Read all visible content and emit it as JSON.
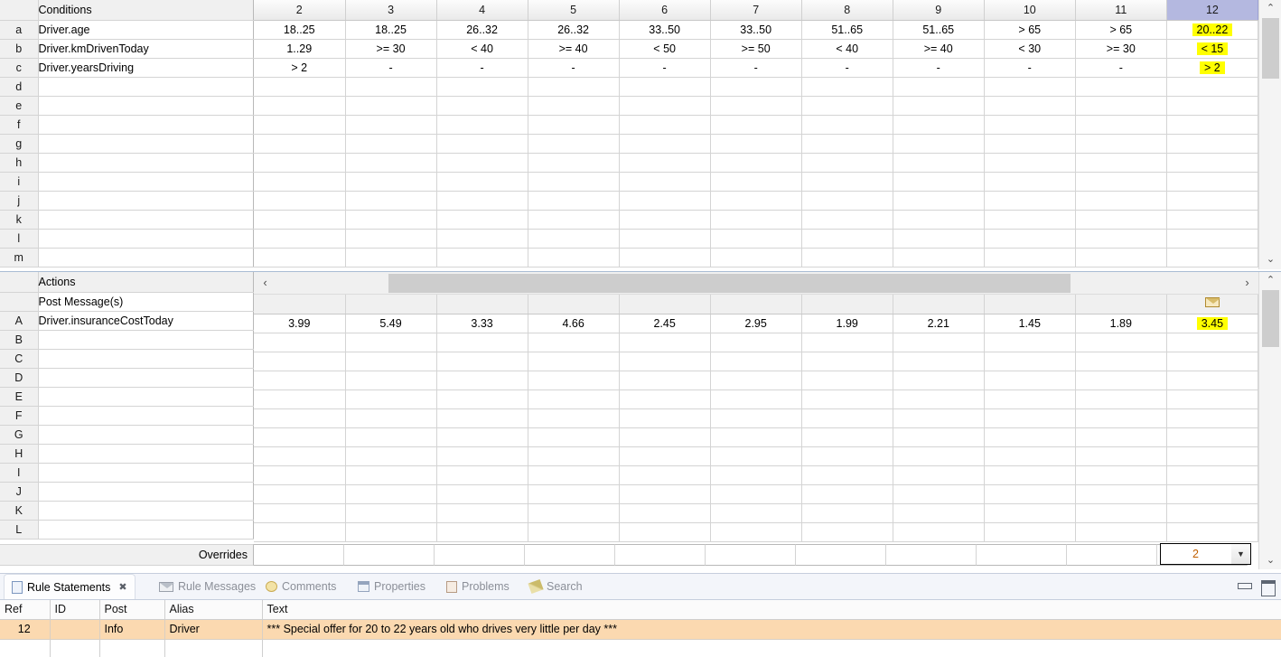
{
  "decision_table": {
    "conditions": {
      "section_label": "Conditions",
      "column_headers": [
        "2",
        "3",
        "4",
        "5",
        "6",
        "7",
        "8",
        "9",
        "10",
        "11",
        "12"
      ],
      "selected_column": "12",
      "rows": [
        {
          "ref": "a",
          "name": "Driver.age",
          "values": [
            "18..25",
            "18..25",
            "26..32",
            "26..32",
            "33..50",
            "33..50",
            "51..65",
            "51..65",
            "> 65",
            "> 65",
            "20..22"
          ]
        },
        {
          "ref": "b",
          "name": "Driver.kmDrivenToday",
          "values": [
            "1..29",
            ">= 30",
            "< 40",
            ">= 40",
            "< 50",
            ">= 50",
            "< 40",
            ">= 40",
            "< 30",
            ">= 30",
            "< 15"
          ]
        },
        {
          "ref": "c",
          "name": "Driver.yearsDriving",
          "values": [
            "> 2",
            "-",
            "-",
            "-",
            "-",
            "-",
            "-",
            "-",
            "-",
            "-",
            "> 2"
          ]
        },
        {
          "ref": "d",
          "name": "",
          "values": [
            "",
            "",
            "",
            "",
            "",
            "",
            "",
            "",
            "",
            "",
            ""
          ]
        },
        {
          "ref": "e",
          "name": "",
          "values": [
            "",
            "",
            "",
            "",
            "",
            "",
            "",
            "",
            "",
            "",
            ""
          ]
        },
        {
          "ref": "f",
          "name": "",
          "values": [
            "",
            "",
            "",
            "",
            "",
            "",
            "",
            "",
            "",
            "",
            ""
          ]
        },
        {
          "ref": "g",
          "name": "",
          "values": [
            "",
            "",
            "",
            "",
            "",
            "",
            "",
            "",
            "",
            "",
            ""
          ]
        },
        {
          "ref": "h",
          "name": "",
          "values": [
            "",
            "",
            "",
            "",
            "",
            "",
            "",
            "",
            "",
            "",
            ""
          ]
        },
        {
          "ref": "i",
          "name": "",
          "values": [
            "",
            "",
            "",
            "",
            "",
            "",
            "",
            "",
            "",
            "",
            ""
          ]
        },
        {
          "ref": "j",
          "name": "",
          "values": [
            "",
            "",
            "",
            "",
            "",
            "",
            "",
            "",
            "",
            "",
            ""
          ]
        },
        {
          "ref": "k",
          "name": "",
          "values": [
            "",
            "",
            "",
            "",
            "",
            "",
            "",
            "",
            "",
            "",
            ""
          ]
        },
        {
          "ref": "l",
          "name": "",
          "values": [
            "",
            "",
            "",
            "",
            "",
            "",
            "",
            "",
            "",
            "",
            ""
          ]
        },
        {
          "ref": "m",
          "name": "",
          "values": [
            "",
            "",
            "",
            "",
            "",
            "",
            "",
            "",
            "",
            "",
            ""
          ]
        }
      ],
      "highlighted_cells": {
        "column": "12",
        "rows": [
          "a",
          "b",
          "c"
        ]
      }
    },
    "actions": {
      "section_label": "Actions",
      "post_message_label": "Post Message(s)",
      "post_message_icons": [
        "",
        "",
        "",
        "",
        "",
        "",
        "",
        "",
        "",
        "",
        "envelope-icon"
      ],
      "rows": [
        {
          "ref": "A",
          "name": "Driver.insuranceCostToday",
          "values": [
            "3.99",
            "5.49",
            "3.33",
            "4.66",
            "2.45",
            "2.95",
            "1.99",
            "2.21",
            "1.45",
            "1.89",
            "3.45"
          ]
        },
        {
          "ref": "B",
          "name": "",
          "values": [
            "",
            "",
            "",
            "",
            "",
            "",
            "",
            "",
            "",
            "",
            ""
          ]
        },
        {
          "ref": "C",
          "name": "",
          "values": [
            "",
            "",
            "",
            "",
            "",
            "",
            "",
            "",
            "",
            "",
            ""
          ]
        },
        {
          "ref": "D",
          "name": "",
          "values": [
            "",
            "",
            "",
            "",
            "",
            "",
            "",
            "",
            "",
            "",
            ""
          ]
        },
        {
          "ref": "E",
          "name": "",
          "values": [
            "",
            "",
            "",
            "",
            "",
            "",
            "",
            "",
            "",
            "",
            ""
          ]
        },
        {
          "ref": "F",
          "name": "",
          "values": [
            "",
            "",
            "",
            "",
            "",
            "",
            "",
            "",
            "",
            "",
            ""
          ]
        },
        {
          "ref": "G",
          "name": "",
          "values": [
            "",
            "",
            "",
            "",
            "",
            "",
            "",
            "",
            "",
            "",
            ""
          ]
        },
        {
          "ref": "H",
          "name": "",
          "values": [
            "",
            "",
            "",
            "",
            "",
            "",
            "",
            "",
            "",
            "",
            ""
          ]
        },
        {
          "ref": "I",
          "name": "",
          "values": [
            "",
            "",
            "",
            "",
            "",
            "",
            "",
            "",
            "",
            "",
            ""
          ]
        },
        {
          "ref": "J",
          "name": "",
          "values": [
            "",
            "",
            "",
            "",
            "",
            "",
            "",
            "",
            "",
            "",
            ""
          ]
        },
        {
          "ref": "K",
          "name": "",
          "values": [
            "",
            "",
            "",
            "",
            "",
            "",
            "",
            "",
            "",
            "",
            ""
          ]
        },
        {
          "ref": "L",
          "name": "",
          "values": [
            "",
            "",
            "",
            "",
            "",
            "",
            "",
            "",
            "",
            "",
            ""
          ]
        }
      ],
      "highlighted_cells": {
        "column": "12",
        "rows": [
          "A"
        ]
      }
    },
    "overrides": {
      "label": "Overrides",
      "selected_value": "2",
      "column": "12"
    },
    "scroll": {
      "left_arrow": "‹",
      "right_arrow": "›",
      "up_arrow": "⌃",
      "down_arrow": "⌄"
    }
  },
  "bottom_view": {
    "tabs": [
      {
        "label": "Rule Statements",
        "icon": "document-icon",
        "active": true,
        "closable": true
      },
      {
        "label": "Rule Messages",
        "icon": "envelope-icon",
        "active": false,
        "closable": false
      },
      {
        "label": "Comments",
        "icon": "comment-icon",
        "active": false,
        "closable": false
      },
      {
        "label": "Properties",
        "icon": "properties-icon",
        "active": false,
        "closable": false
      },
      {
        "label": "Problems",
        "icon": "problems-icon",
        "active": false,
        "closable": false
      },
      {
        "label": "Search",
        "icon": "search-icon",
        "active": false,
        "closable": false
      }
    ],
    "view_buttons": {
      "minimize": "Minimize",
      "maximize": "Maximize"
    },
    "table": {
      "headers": [
        "Ref",
        "ID",
        "Post",
        "Alias",
        "Text"
      ],
      "rows": [
        {
          "ref": "12",
          "id": "",
          "post": "Info",
          "alias": "Driver",
          "text": "*** Special offer for 20 to 22 years old who drives very little per day ***",
          "selected": true
        },
        {
          "ref": "",
          "id": "",
          "post": "",
          "alias": "",
          "text": "",
          "selected": false
        }
      ]
    }
  },
  "colors": {
    "highlight_yellow": "#ffff00",
    "selected_column_header": "#b4b8e0",
    "selected_row": "#fbd9b0"
  }
}
